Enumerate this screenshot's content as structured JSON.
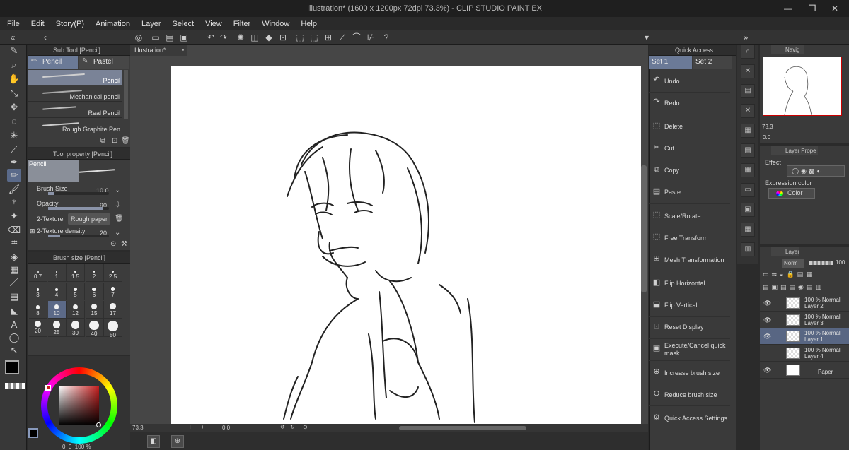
{
  "window": {
    "title": "Illustration* (1600 x 1200px 72dpi 73.3%) - CLIP STUDIO PAINT EX"
  },
  "menu": {
    "items": [
      "File",
      "Edit",
      "Story(P)",
      "Animation",
      "Layer",
      "Select",
      "View",
      "Filter",
      "Window",
      "Help"
    ]
  },
  "subtool": {
    "header": "Sub Tool [Pencil]",
    "tabs": [
      "Pencil",
      "Pastel"
    ],
    "brushes": [
      "Pencil",
      "Mechanical pencil",
      "Real Pencil",
      "Rough Graphite Pen"
    ]
  },
  "toolprop": {
    "header": "Tool property [Pencil]",
    "preview_label": "Pencil",
    "brush_size_label": "Brush Size",
    "brush_size_value": "10.0",
    "brush_size_level": 0.1,
    "opacity_label": "Opacity",
    "opacity_value": "90",
    "opacity_level": 0.9,
    "texture_label": "2-Texture",
    "texture_value": "Rough paper",
    "texture_density_label": "2-Texture density",
    "texture_density_value": "20",
    "texture_density_level": 0.2
  },
  "brushsize": {
    "header": "Brush size [Pencil]",
    "sizes": [
      "0.7",
      "1",
      "1.5",
      "2",
      "2.5",
      "3",
      "4",
      "5",
      "6",
      "7",
      "8",
      "10",
      "12",
      "15",
      "17",
      "20",
      "25",
      "30",
      "40",
      "50"
    ],
    "selected": "10"
  },
  "color": {
    "main": "#000000",
    "sub": "#ffffff",
    "hue_accent": "#c81e1e",
    "readout": "0  0  100 %"
  },
  "document": {
    "tab": "Illustration*",
    "zoom": "73.3",
    "angle": "0.0"
  },
  "quickaccess": {
    "header": "Quick Access",
    "sets": [
      "Set 1",
      "Set 2"
    ],
    "items": [
      {
        "label": "Undo",
        "icon": "undo-icon"
      },
      {
        "label": "Redo",
        "icon": "redo-icon"
      },
      {
        "label": "Delete",
        "icon": "delete-icon"
      },
      {
        "label": "Cut",
        "icon": "scissors-icon"
      },
      {
        "label": "Copy",
        "icon": "copy-icon"
      },
      {
        "label": "Paste",
        "icon": "paste-icon"
      },
      {
        "label": "Scale/Rotate",
        "icon": "scale-icon"
      },
      {
        "label": "Free Transform",
        "icon": "transform-icon"
      },
      {
        "label": "Mesh Transformation",
        "icon": "mesh-icon"
      },
      {
        "label": "Flip Horizontal",
        "icon": "flip-h-icon"
      },
      {
        "label": "Flip Vertical",
        "icon": "flip-v-icon"
      },
      {
        "label": "Reset Display",
        "icon": "reset-icon"
      },
      {
        "label": "Execute/Cancel quick mask",
        "icon": "mask-icon"
      },
      {
        "label": "Increase brush size",
        "icon": "plus-icon"
      },
      {
        "label": "Reduce brush size",
        "icon": "minus-icon"
      },
      {
        "label": "Quick Access Settings",
        "icon": "settings-icon"
      }
    ]
  },
  "navigator": {
    "tab": "Navig",
    "zoom": "73.3",
    "angle": "0.0"
  },
  "layerprop": {
    "tab": "Layer Prope",
    "effect_label": "Effect",
    "expression_label": "Expression color",
    "expression_value": "Color"
  },
  "layers": {
    "tab": "Layer",
    "blend": "Norm",
    "opacity": "100",
    "items": [
      {
        "mode": "100 % Normal",
        "name": "Layer 2"
      },
      {
        "mode": "100 % Normal",
        "name": "Layer 3"
      },
      {
        "mode": "100 % Normal",
        "name": "Layer 1"
      },
      {
        "mode": "100 % Normal",
        "name": "Layer 4"
      },
      {
        "mode": "",
        "name": "Paper"
      }
    ]
  }
}
